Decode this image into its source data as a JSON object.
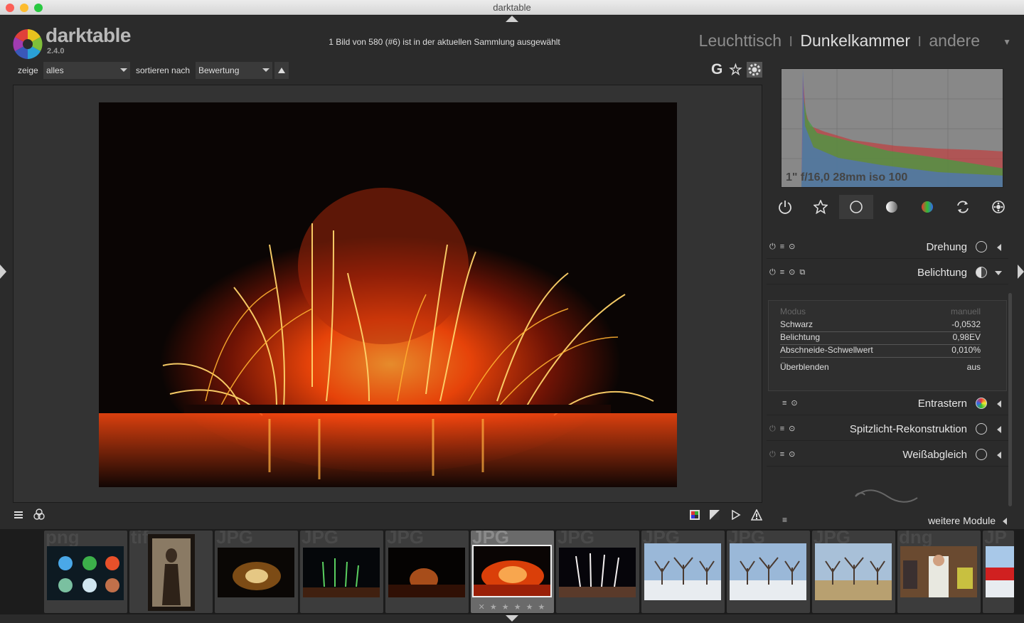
{
  "window": {
    "title": "darktable"
  },
  "brand": {
    "name": "darktable",
    "version": "2.4.0"
  },
  "status": "1 Bild von 580 (#6) ist in der aktuellen Sammlung ausgewählt",
  "views": [
    "Leuchttisch",
    "Dunkelkammer",
    "andere"
  ],
  "view_separator": "I",
  "active_view": "Dunkelkammer",
  "filter": {
    "show_label": "zeige",
    "show_value": "alles",
    "sort_label": "sortieren nach",
    "sort_value": "Bewertung"
  },
  "top_icons": {
    "grouping": "G",
    "star": "☆"
  },
  "histogram": {
    "info": "1\" f/16,0 28mm iso 100"
  },
  "module_groups": [
    "power-icon",
    "favorite-icon",
    "basic-icon",
    "tone-icon",
    "color-icon",
    "correct-icon",
    "effect-icon"
  ],
  "modules": {
    "drehung": "Drehung",
    "belichtung": "Belichtung",
    "entrastern": "Entrastern",
    "spitzlicht": "Spitzlicht-Rekonstruktion",
    "weissabgleich": "Weißabgleich"
  },
  "exposure": {
    "mode_label": "Modus",
    "mode_value": "manuell",
    "black_label": "Schwarz",
    "black_value": "-0,0532",
    "exposure_label": "Belichtung",
    "exposure_value": "0,98EV",
    "clip_label": "Abschneide-Schwellwert",
    "clip_value": "0,010%",
    "blend_label": "Überblenden",
    "blend_value": "aus"
  },
  "more_modules": "weitere Module",
  "filmstrip": {
    "thumbs": [
      {
        "ext": "png",
        "kind": "emoji"
      },
      {
        "ext": "tif",
        "kind": "portrait"
      },
      {
        "ext": "JPG",
        "kind": "fw-gold"
      },
      {
        "ext": "JPG",
        "kind": "fw-green"
      },
      {
        "ext": "JPG",
        "kind": "fw-small"
      },
      {
        "ext": "JPG",
        "kind": "fw-red"
      },
      {
        "ext": "JPG",
        "kind": "fw-white"
      },
      {
        "ext": "JPG",
        "kind": "trees-snow"
      },
      {
        "ext": "JPG",
        "kind": "trees-snow"
      },
      {
        "ext": "JPG",
        "kind": "trees-autumn"
      },
      {
        "ext": "dng",
        "kind": "people"
      },
      {
        "ext": "JP",
        "kind": "car"
      }
    ],
    "selected_index": 5,
    "stars": "✕  ★ ★ ★ ★ ★"
  },
  "colors": {
    "accent": "#ff5a1a",
    "panel": "#2b2b2b"
  }
}
